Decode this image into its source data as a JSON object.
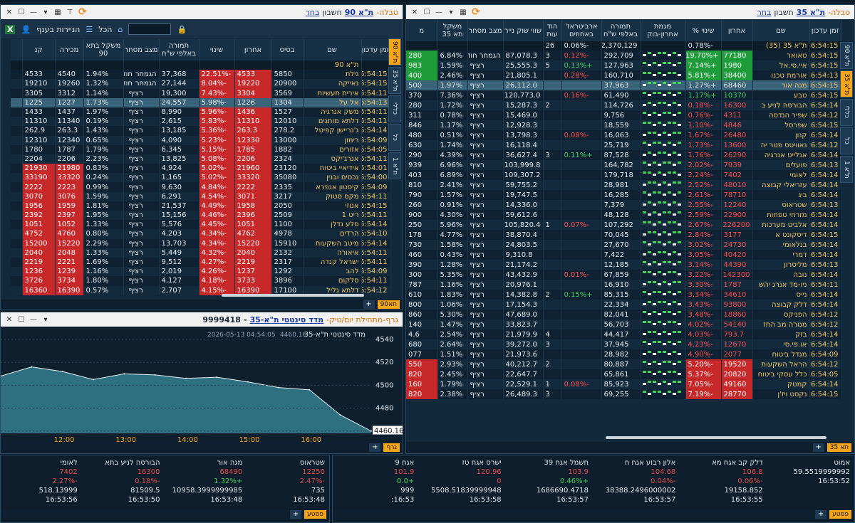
{
  "left": {
    "title": {
      "prefix": "טבלה-",
      "group": "ת\"א 90",
      "account": "חשבון",
      "link": "בחר"
    },
    "toolbar": {
      "excel": "X",
      "rename": "הניירות בענף",
      "all": "הכל",
      "search": ""
    },
    "vtabs": [
      "ת\"א 90",
      "ת\"א 35",
      "כללי",
      "כל",
      "ת\"א 1"
    ],
    "headers": [
      "זמן עדכון",
      "שם",
      "בסיס",
      "אחרון",
      "שינוי",
      "תמורה באלפי ש\"ח",
      "מצב מסחר",
      "משקל בתא 90",
      "מכירה",
      "קנ"
    ],
    "index_row": {
      "name": "ת\"א 90"
    },
    "rows": [
      [
        "16:54:15",
        "גילת",
        "5850",
        "4533",
        "-22.51%",
        "37,368",
        "הגמחר",
        "חודש ר(י",
        "1.94%",
        "4540",
        "4533"
      ],
      [
        "16:54:15",
        "נאייקה",
        "20900",
        "19220",
        "-8.04%",
        "27,144",
        "הגמחר",
        "חודש ר(י",
        "1.32%",
        "19260",
        "19210"
      ],
      [
        "16:54:11",
        "אירית תעשיות",
        "3569",
        "3304",
        "-7.43%",
        "19,300",
        "רציף",
        "",
        "1.14%",
        "3312",
        "3305"
      ],
      [
        "16:54:13",
        "אל על",
        "1304",
        "1226",
        "-5.98%",
        "24,557",
        "רציף",
        "",
        "1.73%",
        "1227",
        "1225"
      ],
      [
        "16:54:11",
        "משק אנרגיה",
        "1527",
        "1436",
        "-5.96%",
        "8,990",
        "רציף",
        "",
        "1.97%",
        "1437",
        "1433"
      ],
      [
        "16:54:11",
        "דלתא מותגים",
        "12010",
        "11310",
        "-5.83%",
        "2,615",
        "רציף",
        "",
        "0.19%",
        "11340",
        "11310"
      ],
      [
        "16:54:14",
        "ג'נריישן קפיטל",
        "278.2",
        "263.3",
        "-5.36%",
        "13,185",
        "רציף",
        "",
        "1.43%",
        "263.3",
        "262.9"
      ],
      [
        "16:54:09",
        "רימון",
        "13000",
        "12330",
        "-5.23%",
        "4,090",
        "רציף",
        "",
        "0.65%",
        "12340",
        "12310"
      ],
      [
        "16:54:05",
        "אזורים",
        "1882",
        "1785",
        "-5.15%",
        "6,345",
        "רציף",
        "",
        "1.79%",
        "1787",
        "1780"
      ],
      [
        "16:54:11",
        "אנרג'יקס",
        "2324",
        "2206",
        "-5.08%",
        "13,825",
        "רציף",
        "",
        "2.23%",
        "2206",
        "2204"
      ],
      [
        "16:54:01",
        "אידיאיי ביטוח",
        "23120",
        "21960",
        "-5.02%",
        "4,924",
        "רציף",
        "",
        "0.83%",
        "21980",
        "21930"
      ],
      [
        "16:54:00",
        "נכסים ובנין",
        "35080",
        "33320",
        "-5.02%",
        "1,165",
        "רציף",
        "",
        "0.24%",
        "33320",
        "33190"
      ],
      [
        "16:54:09",
        "קיסטון אנפרא",
        "2335",
        "2222",
        "-4.84%",
        "9,630",
        "רציף",
        "",
        "0.99%",
        "2223",
        "2222"
      ],
      [
        "16:54:11",
        "מקס סטוק",
        "3217",
        "3071",
        "-4.54%",
        "6,291",
        "רציף",
        "",
        "1.59%",
        "3076",
        "3070"
      ],
      [
        "16:54:15",
        "אנוזי",
        "2050",
        "1958",
        "-4.49%",
        "21,537",
        "רציף",
        "",
        "1.81%",
        "1959",
        "1956"
      ],
      [
        "16:54:11",
        "ריט 1",
        "2509",
        "2396",
        "-4.46%",
        "15,156",
        "רציף",
        "",
        "1.95%",
        "2397",
        "2392"
      ],
      [
        "16:54:14",
        "סלע נדלן",
        "1100",
        "1051",
        "-4.45%",
        "5,576",
        "רציף",
        "",
        "1.33%",
        "1052",
        "1051"
      ],
      [
        "16:54:10",
        "הרדים",
        "4978",
        "4762",
        "-4.34%",
        "4,203",
        "רציף",
        "",
        "0.80%",
        "4760",
        "4752"
      ],
      [
        "16:54:14",
        "מיטב השקעות",
        "15910",
        "15220",
        "-4.34%",
        "13,703",
        "רציף",
        "",
        "2.29%",
        "15220",
        "15200"
      ],
      [
        "16:54:11",
        "איאורה",
        "2132",
        "2040",
        "-4.32%",
        "5,449",
        "רציף",
        "",
        "1.33%",
        "2048",
        "2040"
      ],
      [
        "16:54:11",
        "ישראל קנדה",
        "2317",
        "2219",
        "-4.27%",
        "9,512",
        "רציף",
        "",
        "1.69%",
        "2221",
        "2219"
      ],
      [
        "16:54:09",
        "להב",
        "1292",
        "1237",
        "-4.26%",
        "2,019",
        "רציף",
        "",
        "1.16%",
        "1239",
        "1236"
      ],
      [
        "16:54:11",
        "סלקום",
        "3896",
        "3733",
        "-4.18%",
        "4,127",
        "רציף",
        "",
        "1.80%",
        "3734",
        "3726"
      ],
      [
        "16:54:12",
        "דלתא גליל",
        "17100",
        "16390",
        "-4.15%",
        "2,707",
        "רציף",
        "",
        "0.57%",
        "16390",
        "16360"
      ]
    ],
    "bottom_tab": "תא90"
  },
  "right": {
    "title": {
      "prefix": "טבלה-",
      "group": "ת\"א 35",
      "account": "חשבון",
      "link": "בחר"
    },
    "vtabs": [
      "ת\"א 90",
      "ת\"א 35",
      "כללי",
      "כל",
      "ת\"א 1"
    ],
    "headers": [
      "זמן עדכון",
      "שם",
      "אחרון",
      "שינוי %",
      "מגמת אחרון-בוק",
      "תמורה באלפי ש\"ח",
      "ארביטראז' באחוזים",
      "הוד עות",
      "שווי שוק נייר",
      "מצב מסחר",
      "משקל תא 35",
      "מ"
    ],
    "index_row": [
      "16:54:15",
      "ת\"א 35 (35)",
      "",
      "-0.78%",
      "",
      "2,370,129",
      "-0.06%",
      "26",
      "",
      "",
      "",
      ""
    ],
    "rows": [
      [
        "16:54:15",
        "טאואר",
        "77180",
        "+19.70%",
        "292,709",
        "-0.12%",
        "3",
        "87,078.3",
        "הגמחר חוד",
        "6.84%",
        "280",
        "g"
      ],
      [
        "16:54:15",
        "איי.סי.אל",
        "1980",
        "+7.14%",
        "127,963",
        "+0.13%",
        "5",
        "25,555.3",
        "רציף",
        "1.59%",
        "983",
        "g"
      ],
      [
        "16:54:13",
        "אורמת טכנו",
        "38400",
        "+5.81%",
        "160,710",
        "-0.28%",
        "",
        "21,805.1",
        "רציף",
        "2.46%",
        "400",
        "g"
      ],
      [
        "16:54:15",
        "מגה אור",
        "68460",
        "+1.27%",
        "37,963",
        "",
        "",
        "26,112.0",
        "רציף",
        "1.97%",
        "500",
        "sel"
      ],
      [
        "16:54:15",
        "טבע",
        "10370",
        "+1.17%",
        "61,490",
        "-0.16%",
        "",
        "120,773.0",
        "רציף",
        "7.36%",
        "370",
        "p"
      ],
      [
        "16:54:14",
        "הבורסה לניע ב",
        "16300",
        "-0.18%",
        "114,726",
        "",
        "2",
        "15,287.3",
        "רציף",
        "1.72%",
        "280",
        "n"
      ],
      [
        "16:54:12",
        "שפיר הנדסה",
        "4311",
        "-0.76%",
        "9,756",
        "",
        "",
        "15,469.0",
        "רציף",
        "0.78%",
        "311",
        "n"
      ],
      [
        "16:54:15",
        "שפרסל",
        "4846",
        "-1.10%",
        "18,559",
        "",
        "",
        "12,928.3",
        "רציף",
        "1.17%",
        "846",
        "n"
      ],
      [
        "16:54:14",
        "קנון",
        "26480",
        "-1.67%",
        "16,063",
        "-0.08%",
        "",
        "13,798.3",
        "רציף",
        "0.51%",
        "480",
        "n"
      ],
      [
        "16:54:12",
        "נאוויטס פטר יה",
        "13600",
        "-1.73%",
        "25,719",
        "",
        "",
        "16,118.4",
        "רציף",
        "1.74%",
        "630",
        "n"
      ],
      [
        "16:54:14",
        "אנלייט אנרגיה",
        "26290",
        "-1.76%",
        "87,528",
        "+0.11%",
        "3",
        "36,627.4",
        "רציף",
        "4.39%",
        "290",
        "n"
      ],
      [
        "16:54:13",
        "פועלים",
        "7939",
        "-2.02%",
        "164,782",
        "",
        "",
        "103,999.8",
        "רציף",
        "6.96%",
        "939",
        "n"
      ],
      [
        "16:54:14",
        "לאומי",
        "7402",
        "-2.24%",
        "179,718",
        "",
        "",
        "109,307.2",
        "רציף",
        "6.89%",
        "403",
        "n"
      ],
      [
        "16:54:14",
        "עזריאלי קבוצה",
        "48010",
        "-2.52%",
        "28,981",
        "",
        "",
        "59,755.2",
        "רציף",
        "2.41%",
        "810",
        "n"
      ],
      [
        "16:54:14",
        "ביג",
        "78710",
        "-2.61%",
        "16,285",
        "",
        "",
        "19,747.5",
        "רציף",
        "1.57%",
        "790",
        "n"
      ],
      [
        "16:54:13",
        "שטראוס",
        "12240",
        "-2.55%",
        "7,379",
        "",
        "",
        "14,336.0",
        "רציף",
        "0.91%",
        "260",
        "n"
      ],
      [
        "16:54:14",
        "מזרחי טפחות",
        "22900",
        "-2.59%",
        "48,128",
        "",
        "",
        "59,612.6",
        "רציף",
        "4.30%",
        "900",
        "n"
      ],
      [
        "16:54:14",
        "אלביט מערכות",
        "226200",
        "-2.67%",
        "107,292",
        "-0.07%",
        "1",
        "105,820.4",
        "רציף",
        "5.96%",
        "250",
        "n"
      ],
      [
        "16:54:15",
        "דיסקונט א",
        "3177",
        "-2.84%",
        "70,045",
        "",
        "",
        "38,870.4",
        "רציף",
        "4.77%",
        "178",
        "n"
      ],
      [
        "16:54:14",
        "בנלאומי",
        "24730",
        "-3.02%",
        "27,670",
        "",
        "",
        "24,803.5",
        "רציף",
        "1.58%",
        "730",
        "n"
      ],
      [
        "16:54:14",
        "דמרי",
        "40420",
        "-3.05%",
        "7,422",
        "",
        "",
        "9,310.8",
        "רציף",
        "0.43%",
        "460",
        "n"
      ],
      [
        "16:54:13",
        "מליסרון",
        "44390",
        "-3.14%",
        "12,185",
        "",
        "",
        "21,174.2",
        "רציף",
        "1.28%",
        "390",
        "n"
      ],
      [
        "16:54:14",
        "נובה",
        "142300",
        "-3.22%",
        "67,859",
        "-0.01%",
        "",
        "43,432.9",
        "רציף",
        "5.35%",
        "300",
        "n"
      ],
      [
        "16:54:11",
        "ניו-מד אנרג יהש",
        "1787",
        "-3.30%",
        "16,910",
        "",
        "",
        "20,976.1",
        "רציף",
        "1.16%",
        "787",
        "n"
      ],
      [
        "16:54:14",
        "נייס",
        "34610",
        "-3.34%",
        "85,315",
        "+0.15%",
        "2",
        "14,382.8",
        "רציף",
        "1.83%",
        "610",
        "n"
      ],
      [
        "16:54:14",
        "דלק קבוצה",
        "93800",
        "-3.43%",
        "22,334",
        "",
        "",
        "17,154.3",
        "רציף",
        "1.06%",
        "800",
        "n"
      ],
      [
        "16:54:12",
        "הפניקס",
        "18860",
        "-3.48%",
        "82,041",
        "",
        "",
        "47,689.0",
        "רציף",
        "5.30%",
        "860",
        "n"
      ],
      [
        "16:54:12",
        "מנורה מב החז",
        "54140",
        "-4.02%",
        "56,703",
        "",
        "",
        "33,823.7",
        "רציף",
        "1.47%",
        "140",
        "n"
      ],
      [
        "16:54:14",
        "בזק",
        "793.7",
        "-4.03%",
        "44,417",
        "",
        "4",
        "21,979.9",
        "רציף",
        "2.54%",
        "4.6",
        "n"
      ],
      [
        "16:54:14",
        "או.פי.סי",
        "12670",
        "-4.23%",
        "37,945",
        "",
        "3",
        "39,272.0",
        "רציף",
        "2.64%",
        "680",
        "n"
      ],
      [
        "16:54:09",
        "מגדל ביטוח",
        "2077",
        "-4.90%",
        "28,982",
        "",
        "",
        "21,973.6",
        "רציף",
        "1.51%",
        "077",
        "n"
      ],
      [
        "16:54:12",
        "הראל השקעות",
        "19520",
        "-5.20%",
        "80,887",
        "",
        "2",
        "40,212.7",
        "רציף",
        "2.93%",
        "550",
        "r"
      ],
      [
        "16:54:05",
        "כלל עסקי ביטוח",
        "20820",
        "-5.37%",
        "65,861",
        "",
        "",
        "22,647.7",
        "רציף",
        "2.45%",
        "820",
        "r"
      ],
      [
        "16:54:14",
        "קמטק",
        "49160",
        "-7.05%",
        "85,923",
        "-0.08%",
        "1",
        "22,529.1",
        "רציף",
        "1.79%",
        "160",
        "r"
      ],
      [
        "16:54:15",
        "נקסט ויז'ן",
        "28770",
        "-7.19%",
        "69,255",
        "",
        "3",
        "26,489.3",
        "רציף",
        "2.38%",
        "820",
        "r"
      ]
    ],
    "bottom_tab": "תא 35"
  },
  "graph": {
    "title": "גרף-מתחילת יום/טיק-",
    "instrument": "מדד סינטטי ת\"א-35",
    "id": "9999418",
    "timestamp": "2026-05-13 04:54:05",
    "last": "4460.16",
    "legend": "מדד סינטטי ת\"א-35",
    "tab": "גרף",
    "value_box": "4460.16"
  },
  "chart_data": {
    "type": "area",
    "title": "מדד סינטטי ת\"א-35",
    "x": [
      "11:00",
      "11:30",
      "12:00",
      "12:30",
      "13:00",
      "13:30",
      "14:00",
      "14:30",
      "15:00",
      "15:30",
      "16:00",
      "16:30",
      "16:54"
    ],
    "xticks": [
      "12:00",
      "13:00",
      "14:00",
      "15:00",
      "16:00"
    ],
    "yticks": [
      "4460",
      "4480",
      "4500",
      "4520",
      "4540"
    ],
    "values": [
      4508,
      4516,
      4512,
      4505,
      4510,
      4509,
      4506,
      4507,
      4503,
      4498,
      4496,
      4474,
      4460
    ],
    "ylim": [
      4458,
      4545
    ]
  },
  "tickers": {
    "left": [
      {
        "name": "שטראוס",
        "last": "12250",
        "pct": "-2.47%",
        "vol": "735",
        "time": "16:53:48"
      },
      {
        "name": "מגה אור",
        "last": "68490",
        "pct": "+1.32%",
        "vol": "10958.3999999985",
        "time": "16:53:48"
      },
      {
        "name": "הבורסה לניע בתא",
        "last": "16300",
        "pct": "-0.18%",
        "vol": "81509.5",
        "time": "16:53:50"
      },
      {
        "name": "לאומי",
        "last": "7402",
        "pct": "-2.27%",
        "vol": "518.13999",
        "time": "16:53:56"
      }
    ],
    "right": [
      {
        "name": "אמוט",
        "last": "",
        "pct": "",
        "vol": "59.5519999992",
        "time": "16:53:52"
      },
      {
        "name": "דלק קב אגח מא",
        "last": "106.8",
        "pct": "-0.06%",
        "vol": "19158.852",
        "time": "16:53:55"
      },
      {
        "name": "אלון רבוע אגח ח",
        "last": "104.68",
        "pct": "-0.04%",
        "vol": "38388.2496000002",
        "time": "16:53:57"
      },
      {
        "name": "חשמל אגח 39",
        "last": "103.9",
        "pct": "+0.46%",
        "vol": "1686690.4718",
        "time": "16:53:57"
      },
      {
        "name": "ישרס אגח טז",
        "last": "120.96",
        "pct": "0",
        "vol": "5508.51839999948",
        "time": "16:53:58"
      },
      {
        "name": "אגח 9",
        "last": "101.9",
        "pct": "+0.0",
        "vol": "999",
        "time": "16:53:"
      }
    ],
    "tab": "פסטע"
  }
}
